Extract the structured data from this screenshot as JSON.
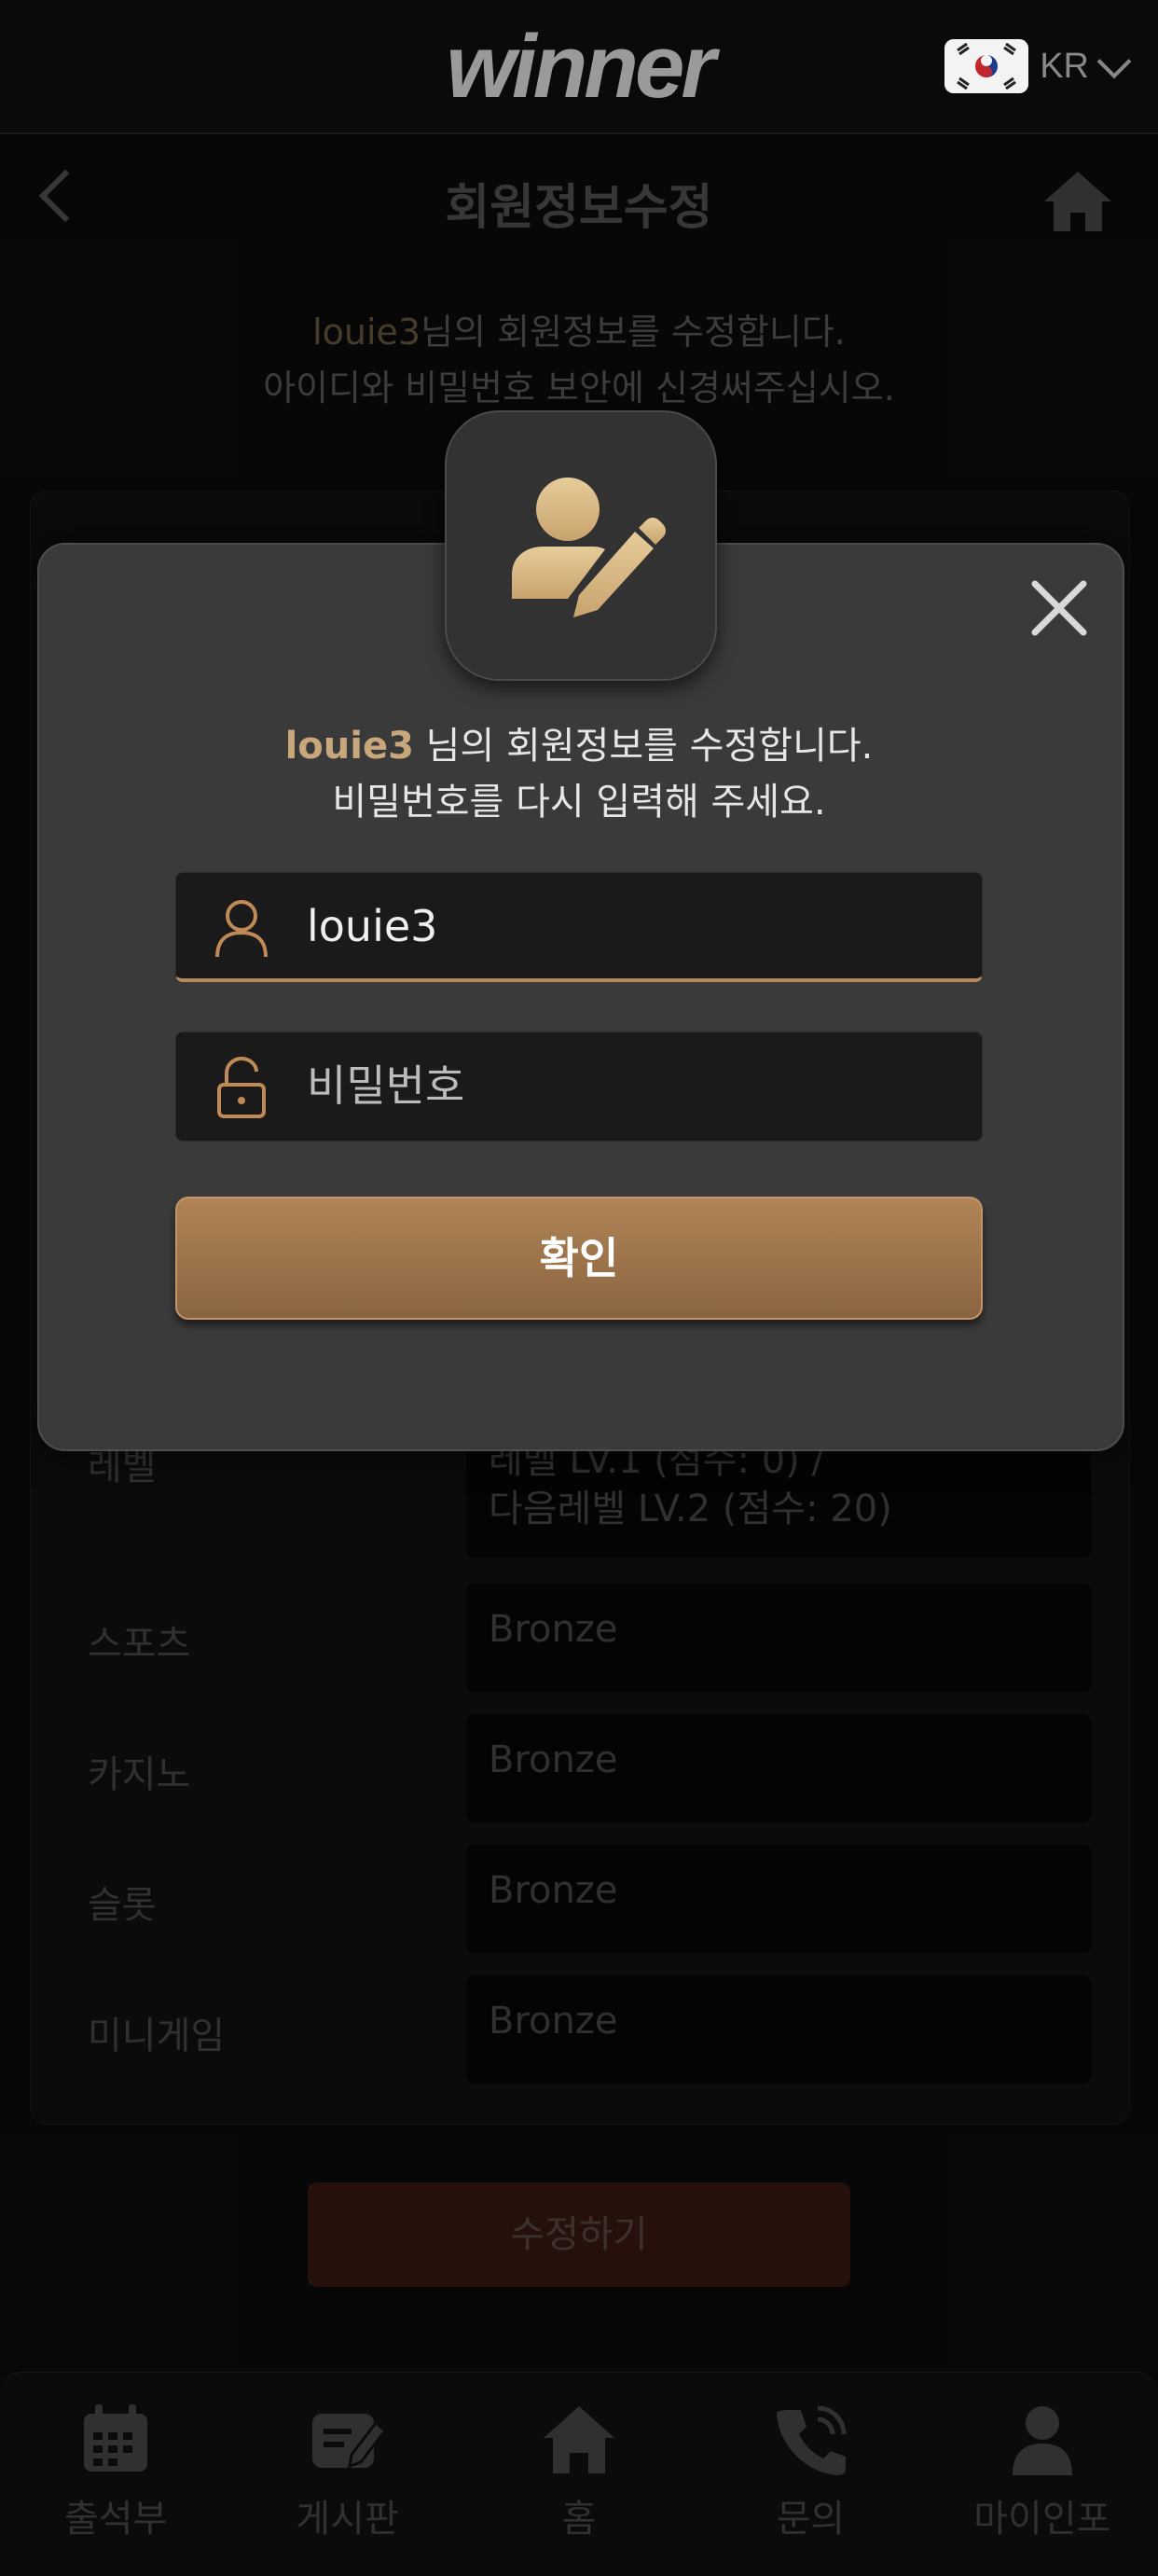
{
  "header": {
    "logo": "winner",
    "lang_code": "KR"
  },
  "page": {
    "title": "회원정보수정",
    "intro_username": "louie3",
    "intro_line1_rest": "님의 회원정보를 수정합니다.",
    "intro_line2": "아이디와 비밀번호 보안에 신경써주십시오."
  },
  "form": {
    "level": {
      "label": "레벨",
      "line1": "레벨 LV.1 (점수: 0) /",
      "line2": "다음레벨 LV.2 (점수: 20)"
    },
    "rows": [
      {
        "label": "스포츠",
        "value": "Bronze"
      },
      {
        "label": "카지노",
        "value": "Bronze"
      },
      {
        "label": "슬롯",
        "value": "Bronze"
      },
      {
        "label": "미니게임",
        "value": "Bronze"
      }
    ],
    "submit_label": "수정하기"
  },
  "modal": {
    "username": "louie3",
    "line1_rest": " 님의 회원정보를 수정합니다.",
    "line2": "비밀번호를 다시 입력해 주세요.",
    "username_value": "louie3",
    "password_placeholder": "비밀번호",
    "confirm_label": "확인"
  },
  "bottom_nav": [
    {
      "label": "출석부",
      "icon": "calendar-icon"
    },
    {
      "label": "게시판",
      "icon": "board-edit-icon"
    },
    {
      "label": "홈",
      "icon": "home-icon"
    },
    {
      "label": "문의",
      "icon": "phone-icon"
    },
    {
      "label": "마이인포",
      "icon": "user-icon"
    }
  ],
  "colors": {
    "accent_gold": "#c9a77c",
    "button_gold": "#a07850",
    "submit_dark_red": "#3b1a12",
    "modal_bg": "#3a3a3a"
  }
}
